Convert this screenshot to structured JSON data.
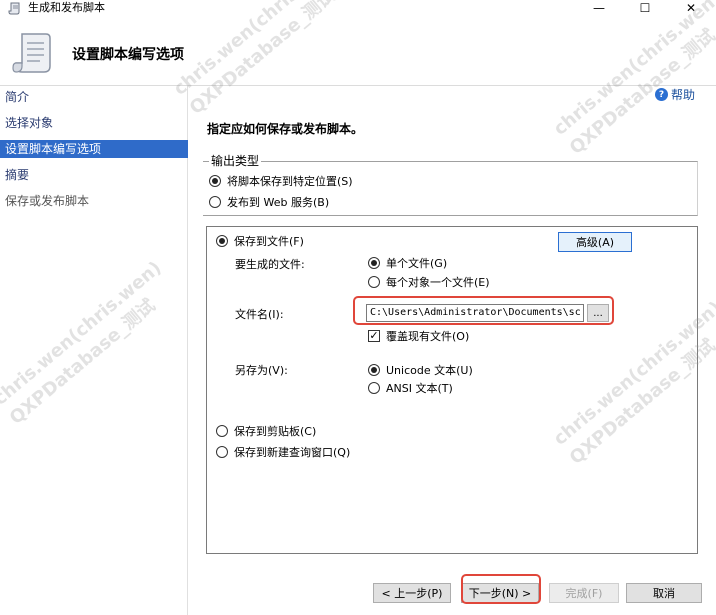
{
  "window": {
    "title": "生成和发布脚本",
    "minimize": "—",
    "maximize": "☐",
    "close": "✕"
  },
  "header": {
    "title": "设置脚本编写选项"
  },
  "sidebar": {
    "items": [
      {
        "label": "简介"
      },
      {
        "label": "选择对象"
      },
      {
        "label": "设置脚本编写选项"
      },
      {
        "label": "摘要"
      },
      {
        "label": "保存或发布脚本"
      }
    ]
  },
  "main": {
    "help_label": "帮助",
    "instruction": "指定应如何保存或发布脚本。",
    "output_type": {
      "legend": "输出类型",
      "save_to_location": "将脚本保存到特定位置(S)",
      "publish_web": "发布到 Web 服务(B)"
    },
    "save_to_file": {
      "label": "保存到文件(F)",
      "advanced_button": "高级(A)",
      "files_to_generate_label": "要生成的文件:",
      "single_file": "单个文件(G)",
      "one_file_per_object": "每个对象一个文件(E)",
      "file_name_label": "文件名(I):",
      "file_name_value": "C:\\Users\\Administrator\\Documents\\sc",
      "browse_label": "...",
      "overwrite_label": "覆盖现有文件(O)",
      "save_as_label": "另存为(V):",
      "unicode_text": "Unicode 文本(U)",
      "ansi_text": "ANSI 文本(T)"
    },
    "save_to_clipboard": "保存到剪贴板(C)",
    "save_to_new_query": "保存到新建查询窗口(Q)"
  },
  "footer": {
    "back": "< 上一步(P)",
    "next": "下一步(N) >",
    "finish": "完成(F)",
    "cancel": "取消"
  },
  "watermark": {
    "line1": "chris.wen(chris.wen)",
    "line2": "QXPDatabase_测试"
  },
  "colors": {
    "sidebar_active": "#2f6bc9",
    "highlight": "#e0463a",
    "link": "#1a4f9c"
  }
}
